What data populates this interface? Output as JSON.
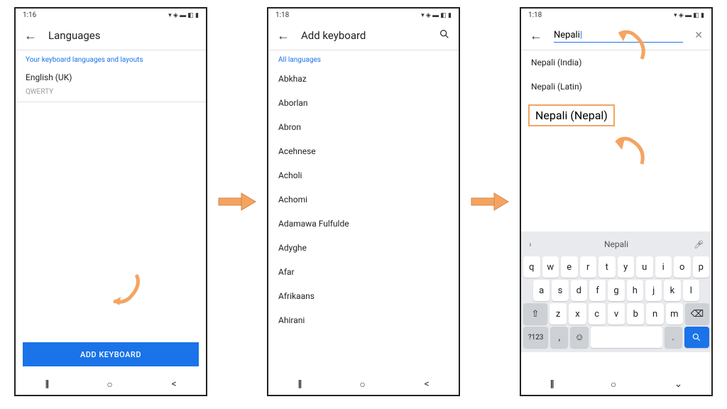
{
  "screen1": {
    "time": "1:16",
    "title": "Languages",
    "section": "Your keyboard languages and layouts",
    "lang": "English (UK)",
    "layout": "QWERTY",
    "button": "ADD KEYBOARD"
  },
  "screen2": {
    "time": "1:18",
    "title": "Add keyboard",
    "section": "All languages",
    "items": [
      "Abkhaz",
      "Aborlan",
      "Abron",
      "Acehnese",
      "Acholi",
      "Achomi",
      "Adamawa Fulfulde",
      "Adyghe",
      "Afar",
      "Afrikaans",
      "Ahirani"
    ]
  },
  "screen3": {
    "time": "1:18",
    "search": "Nepali",
    "results": [
      "Nepali (India)",
      "Nepali (Latin)",
      "Nepali (Nepal)"
    ],
    "suggestion": "Nepali",
    "symkey": "?123",
    "rows": {
      "r1": [
        "q",
        "w",
        "e",
        "r",
        "t",
        "y",
        "u",
        "i",
        "o",
        "p"
      ],
      "r2": [
        "a",
        "s",
        "d",
        "f",
        "g",
        "h",
        "j",
        "k",
        "l"
      ],
      "r3": [
        "z",
        "x",
        "c",
        "v",
        "b",
        "n",
        "m"
      ]
    }
  },
  "nav": {
    "recent": "|||",
    "home": "○",
    "back": "<"
  }
}
